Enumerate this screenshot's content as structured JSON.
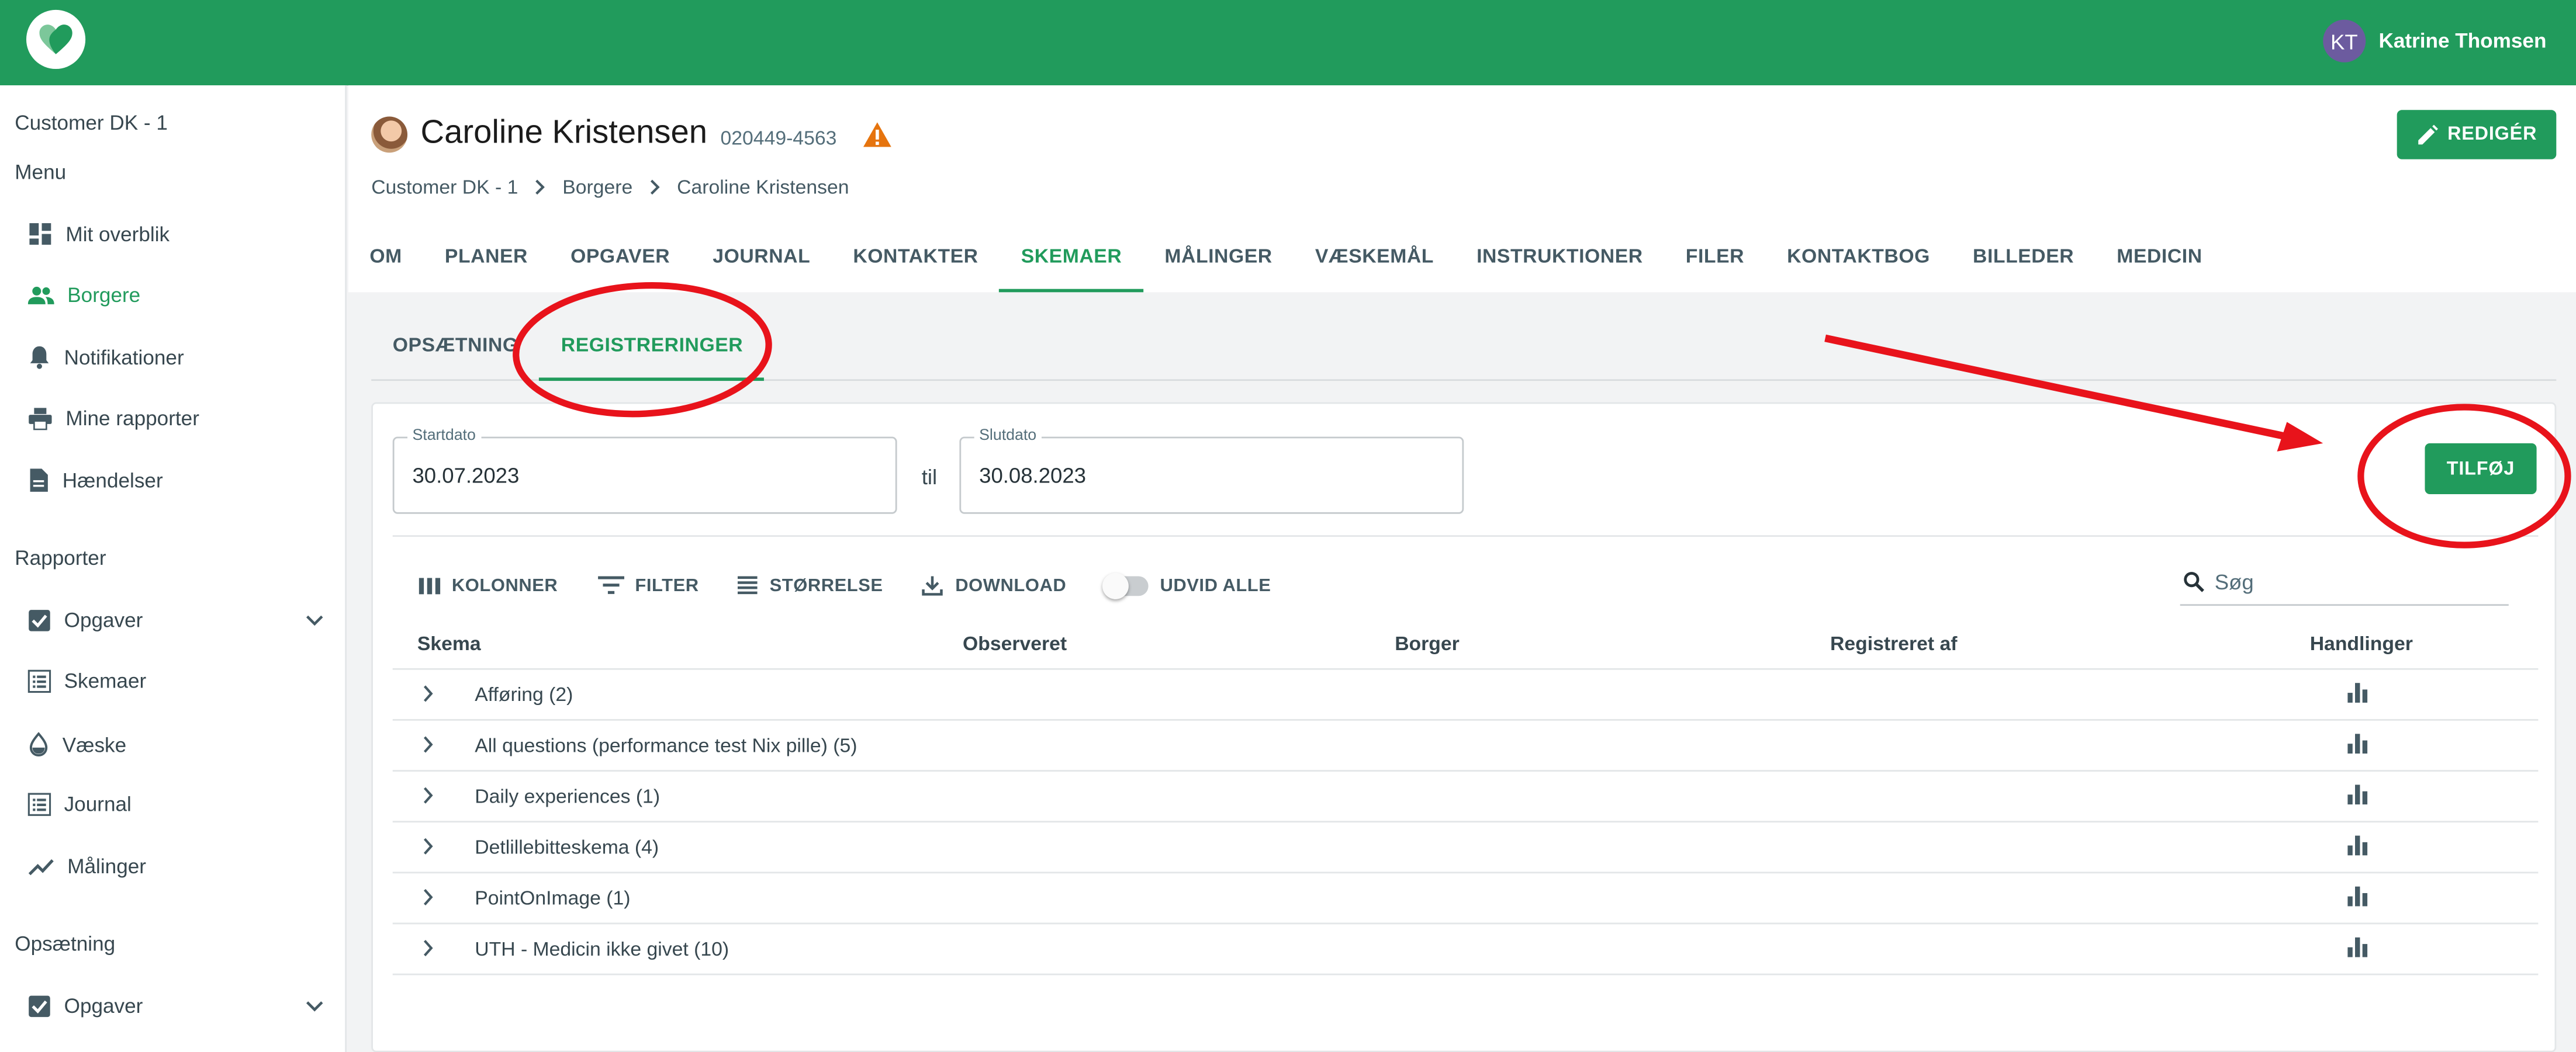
{
  "colors": {
    "brand": "#219b5c",
    "annotation": "#e8131b",
    "warning": "#e6740e",
    "avatar": "#6c5b9f"
  },
  "topbar": {
    "user_initials": "KT",
    "user_name": "Katrine Thomsen"
  },
  "sidebar": {
    "org": "Customer DK - 1",
    "menu_heading": "Menu",
    "menu_items": [
      {
        "label": "Mit overblik",
        "icon": "dashboard-icon"
      },
      {
        "label": "Borgere",
        "icon": "people-icon"
      },
      {
        "label": "Notifikationer",
        "icon": "bell-icon"
      },
      {
        "label": "Mine rapporter",
        "icon": "printer-icon"
      },
      {
        "label": "Hændelser",
        "icon": "document-icon"
      }
    ],
    "reports_heading": "Rapporter",
    "report_items": [
      {
        "label": "Opgaver",
        "icon": "checkbox-icon"
      },
      {
        "label": "Skemaer",
        "icon": "list-icon"
      },
      {
        "label": "Væske",
        "icon": "drop-icon"
      },
      {
        "label": "Journal",
        "icon": "list-icon"
      },
      {
        "label": "Målinger",
        "icon": "trend-icon"
      }
    ],
    "setup_heading": "Opsætning",
    "setup_items": [
      {
        "label": "Opgaver",
        "icon": "checkbox-icon"
      }
    ]
  },
  "patient": {
    "name": "Caroline Kristensen",
    "id": "020449-4563"
  },
  "breadcrumbs": [
    "Customer DK - 1",
    "Borgere",
    "Caroline Kristensen"
  ],
  "edit_label": "REDIGÉR",
  "tabs": [
    "OM",
    "PLANER",
    "OPGAVER",
    "JOURNAL",
    "KONTAKTER",
    "SKEMAER",
    "MÅLINGER",
    "VÆSKEMÅL",
    "INSTRUKTIONER",
    "FILER",
    "KONTAKTBOG",
    "BILLEDER",
    "MEDICIN"
  ],
  "subtabs": [
    "OPSÆTNING",
    "REGISTRERINGER"
  ],
  "filters": {
    "start_label": "Startdato",
    "start_value": "30.07.2023",
    "til": "til",
    "end_label": "Slutdato",
    "end_value": "30.08.2023"
  },
  "add_label": "TILFØJ",
  "toolbar": {
    "columns": "KOLONNER",
    "filter": "FILTER",
    "size": "STØRRELSE",
    "download": "DOWNLOAD",
    "expand_all": "UDVID ALLE"
  },
  "search": {
    "placeholder": "Søg"
  },
  "table": {
    "headers": [
      "Skema",
      "Observeret",
      "Borger",
      "Registreret af",
      "Handlinger"
    ],
    "rows": [
      "Afføring (2)",
      "All questions (performance test Nix pille) (5)",
      "Daily experiences (1)",
      "Detlillebitteskema (4)",
      "PointOnImage (1)",
      "UTH - Medicin ikke givet (10)"
    ]
  }
}
